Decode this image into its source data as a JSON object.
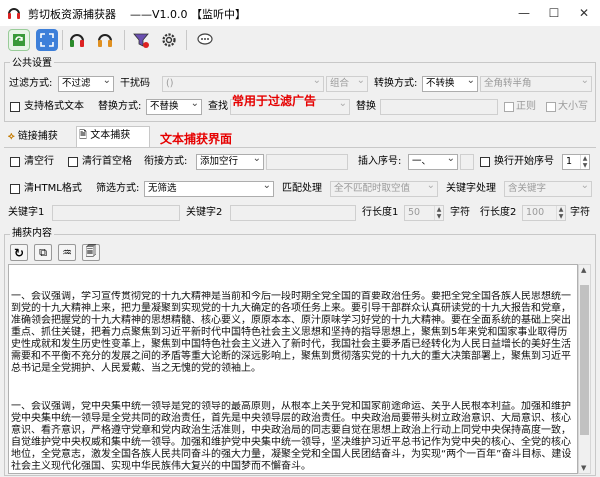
{
  "window": {
    "title": "剪切板资源捕获器    ——V1.0.0 【监听中】",
    "min_icon": "—",
    "max_icon": "☐",
    "close_icon": "✕"
  },
  "toolbar": {
    "icons": [
      "refresh-capture-icon",
      "fullscreen-icon",
      "headphone-listen-icon",
      "headphone-stop-icon",
      "filter-icon",
      "gear-icon",
      "chat-bubble-icon"
    ]
  },
  "common": {
    "group_title": "公共设置",
    "filter_mode_label": "过滤方式:",
    "filter_mode_value": "不过滤",
    "interference_label": "干扰码",
    "interference_value": "()",
    "combine_value": "组合",
    "convert_mode_label": "转换方式:",
    "convert_mode_value": "不转换",
    "fullwidth_value": "全角转半角",
    "support_format_label": "支持格式文本",
    "replace_mode_label": "替换方式:",
    "replace_mode_value": "不替换",
    "find_label": "查找",
    "replace_label": "替换",
    "regex_label": "正则",
    "case_label": "大小写",
    "annotation_filter": "常用于过滤广告"
  },
  "tabs": {
    "link_capture": "链接捕获",
    "text_capture": "文本捕获",
    "annotation_text": "文本捕获界面"
  },
  "text_panel": {
    "clear_lines_label": "清空行",
    "clear_lines_spaces_label": "清行首空格",
    "join_mode_label": "衔接方式:",
    "join_mode_value": "添加空行",
    "insert_num_label": "插入序号:",
    "insert_num_value": "一、",
    "newline_label": "换行",
    "start_num_label": "开始序号",
    "start_num_value": "1",
    "clear_html_label": "清HTML格式",
    "filter_mode_label": "筛选方式:",
    "filter_mode_value": "无筛选",
    "match_label": "匹配处理",
    "match_value": "全不匹配时取空值",
    "keyword_proc_label": "关键字处理",
    "keyword_proc_value": "含关键字",
    "keyword1_label": "关键字1",
    "keyword2_label": "关键字2",
    "row_len1_label": "行长度1",
    "row_len1_value": "50",
    "chars_label1": "字符",
    "row_len2_label": "行长度2",
    "row_len2_value": "100",
    "chars_label2": "字符",
    "capture_content_label": "捕获内容"
  },
  "content": {
    "p1": "一、会议强调，学习宣传贯彻党的十九大精神是当前和今后一段时期全党全国的首要政治任务。要把全党全国各族人民思想统一到党的十九大精神上来，把力量凝聚到实现党的十九大确定的各项任务上来。要引导干部群众认真研读党的十九大报告和党章，准确领会把握党的十九大精神的思想精髓、核心要义，原原本本、原汁原味学习好党的十九大精神。要在全面系统的基础上突出重点、抓住关键，把着力点聚焦到习近平新时代中国特色社会主义思想和坚持的指导思想上，聚焦到5年来党和国家事业取得历史性成就和发生历史性变革上，聚焦到中国特色社会主义进入了新时代，我国社会主要矛盾已经转化为人民日益增长的美好生活需要和不平衡不充分的发展之间的矛盾等重大论断的深远影响上，聚焦到贯彻落实党的十九大的重大决策部署上，聚焦到习近平总书记是全党拥护、人民爱戴、当之无愧的党的领袖上。",
    "p2": "一、会议强调，党中央集中统一领导是党的领导的最高原则，从根本上关乎党和国家前途命运、关乎人民根本利益。加强和维护党中央集中统一领导是全党共同的政治责任，首先是中央领导层的政治责任。中央政治局要带头树立政治意识、大局意识、核心意识、看齐意识，严格遵守党章和党内政治生活准则，中央政治局的同志要自觉在思想上政治上行动上同党中央保持高度一致，自觉维护党中央权威和集中统一领导。加强和维护党中央集中统一领导，坚决维护习近平总书记作为党中央的核心、全党的核心地位，全党意志，激发全国各族人民共同奋斗的强大力量，凝聚全党和全国人民团结奋斗，为实现“两个一百年”奋斗目标、建设社会主义现代化强国、实现中华民族伟大复兴的中国梦而不懈奋斗。"
  }
}
